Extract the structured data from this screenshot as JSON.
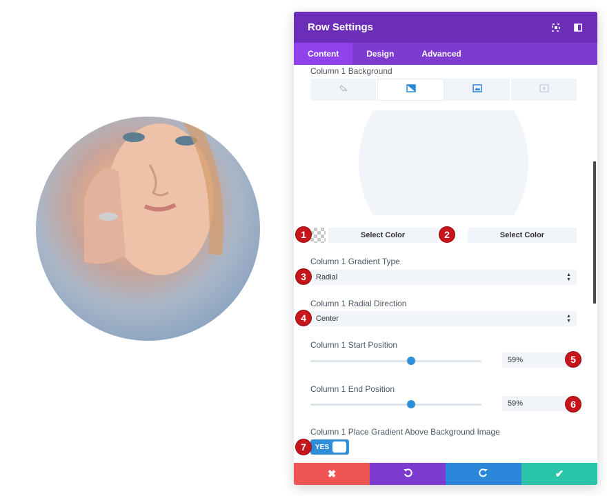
{
  "panel": {
    "title": "Row Settings",
    "tabs": [
      {
        "label": "Content",
        "active": true
      },
      {
        "label": "Design",
        "active": false
      },
      {
        "label": "Advanced",
        "active": false
      }
    ]
  },
  "background": {
    "section_label": "Column 1 Background",
    "tabs": [
      "paint-bucket-icon",
      "gradient-icon",
      "image-icon",
      "video-icon"
    ],
    "active_tab": "gradient-icon"
  },
  "colors": {
    "start_label": "Select Color",
    "end_label": "Select Color"
  },
  "gradient_type": {
    "label": "Column 1 Gradient Type",
    "value": "Radial"
  },
  "radial_direction": {
    "label": "Column 1 Radial Direction",
    "value": "Center"
  },
  "start_position": {
    "label": "Column 1 Start Position",
    "value": "59%",
    "fraction": 0.59
  },
  "end_position": {
    "label": "Column 1 End Position",
    "value": "59%",
    "fraction": 0.59
  },
  "place_above": {
    "label": "Column 1 Place Gradient Above Background Image",
    "toggle_text": "YES"
  },
  "badges": [
    "1",
    "2",
    "3",
    "4",
    "5",
    "6",
    "7"
  ],
  "footer": {
    "colors": {
      "cancel": "#ef5555",
      "undo": "#7e3bd0",
      "redo": "#2b87da",
      "save": "#29c4a9"
    }
  },
  "accent": "#7d3bcf"
}
